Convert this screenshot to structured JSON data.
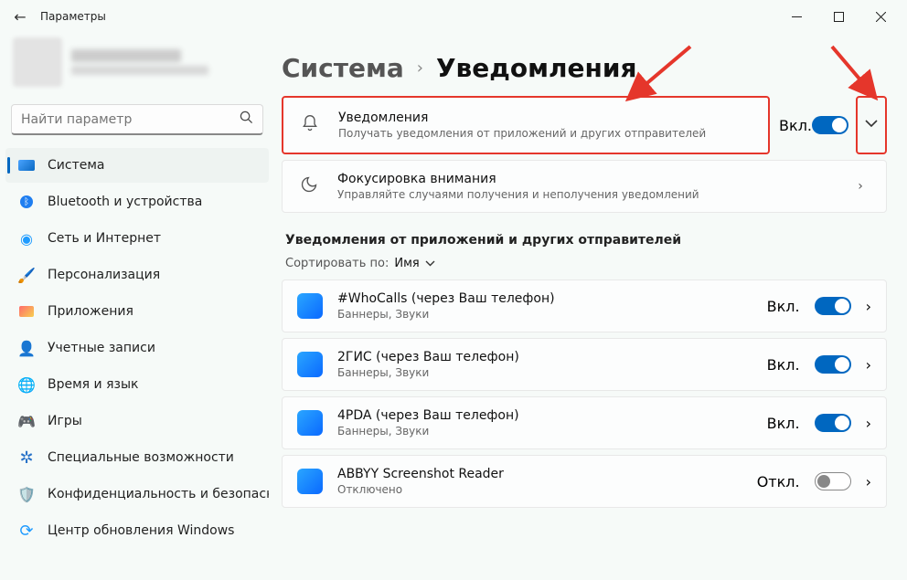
{
  "titlebar": {
    "title": "Параметры"
  },
  "search": {
    "placeholder": "Найти параметр"
  },
  "nav": {
    "system": "Система",
    "bluetooth": "Bluetooth и устройства",
    "network": "Сеть и Интернет",
    "personalization": "Персонализация",
    "apps": "Приложения",
    "accounts": "Учетные записи",
    "time": "Время и язык",
    "gaming": "Игры",
    "accessibility": "Специальные возможности",
    "privacy": "Конфиденциальность и безопасность",
    "update": "Центр обновления Windows"
  },
  "breadcrumb": {
    "parent": "Система",
    "current": "Уведомления"
  },
  "cards": {
    "notifications": {
      "title": "Уведомления",
      "sub": "Получать уведомления от приложений и других отправителей",
      "state": "Вкл."
    },
    "focus": {
      "title": "Фокусировка внимания",
      "sub": "Управляйте случаями получения и неполучения уведомлений"
    }
  },
  "section": "Уведомления от приложений и других отправителей",
  "sort": {
    "label": "Сортировать по:",
    "value": "Имя"
  },
  "apps": [
    {
      "name": "#WhoCalls (через Ваш телефон)",
      "sub": "Баннеры, Звуки",
      "state": "Вкл.",
      "on": true
    },
    {
      "name": "2ГИС (через Ваш телефон)",
      "sub": "Баннеры, Звуки",
      "state": "Вкл.",
      "on": true
    },
    {
      "name": "4PDA (через Ваш телефон)",
      "sub": "Баннеры, Звуки",
      "state": "Вкл.",
      "on": true
    },
    {
      "name": "ABBYY Screenshot Reader",
      "sub": "Отключено",
      "state": "Откл.",
      "on": false
    }
  ]
}
